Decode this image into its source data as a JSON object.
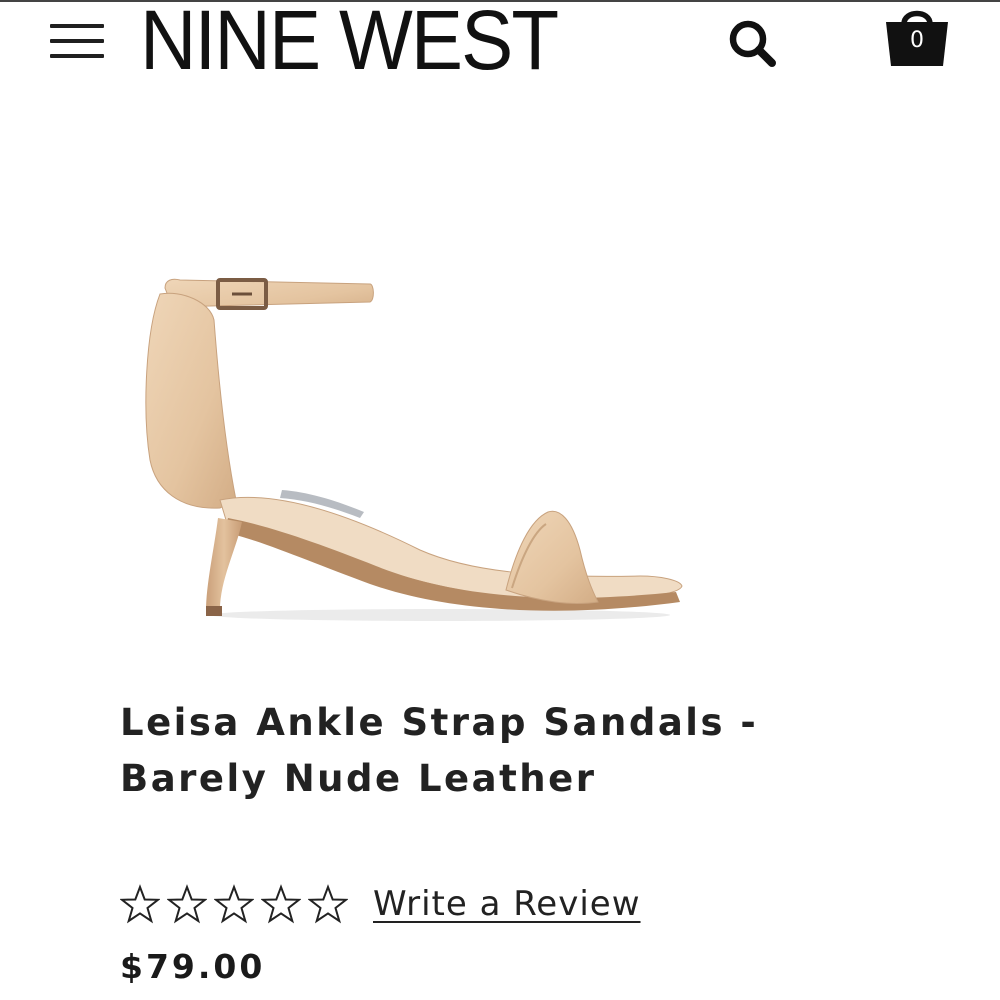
{
  "header": {
    "brand": "NINE WEST",
    "cart_count": "0"
  },
  "product": {
    "title": "Leisa Ankle Strap Sandals - Barely Nude Leather",
    "price": "$79.00",
    "rating": 0,
    "rating_max": 5,
    "review_link": "Write a Review",
    "color": "#e6c8a6"
  },
  "icons": {
    "menu": "hamburger-icon",
    "search": "search-icon",
    "cart": "shopping-bag-icon",
    "star": "star-outline-icon"
  },
  "colors": {
    "text": "#222222",
    "leather": "#e6c8a6",
    "icon": "#111111"
  }
}
